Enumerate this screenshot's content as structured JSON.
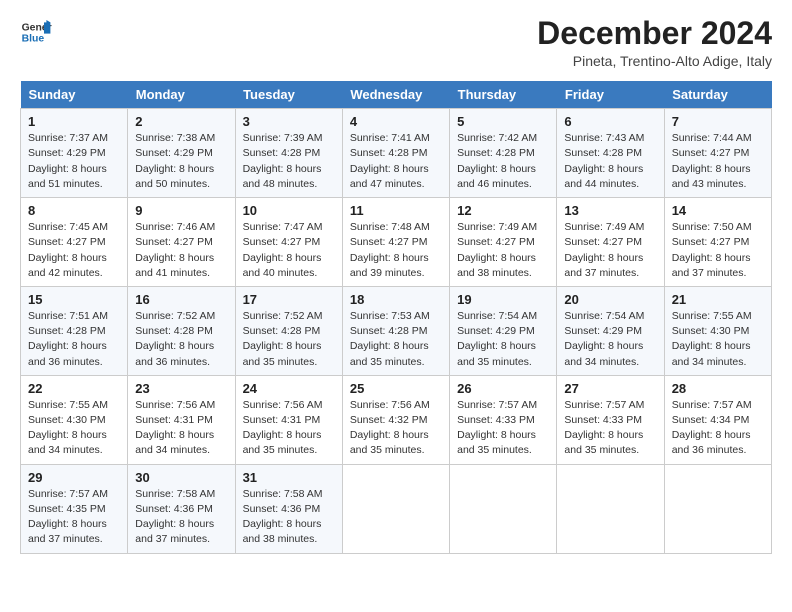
{
  "header": {
    "logo_line1": "General",
    "logo_line2": "Blue",
    "title": "December 2024",
    "subtitle": "Pineta, Trentino-Alto Adige, Italy"
  },
  "days_of_week": [
    "Sunday",
    "Monday",
    "Tuesday",
    "Wednesday",
    "Thursday",
    "Friday",
    "Saturday"
  ],
  "weeks": [
    [
      {
        "day": 1,
        "rise": "7:37 AM",
        "set": "4:29 PM",
        "daylight": "8 hours and 51 minutes."
      },
      {
        "day": 2,
        "rise": "7:38 AM",
        "set": "4:29 PM",
        "daylight": "8 hours and 50 minutes."
      },
      {
        "day": 3,
        "rise": "7:39 AM",
        "set": "4:28 PM",
        "daylight": "8 hours and 48 minutes."
      },
      {
        "day": 4,
        "rise": "7:41 AM",
        "set": "4:28 PM",
        "daylight": "8 hours and 47 minutes."
      },
      {
        "day": 5,
        "rise": "7:42 AM",
        "set": "4:28 PM",
        "daylight": "8 hours and 46 minutes."
      },
      {
        "day": 6,
        "rise": "7:43 AM",
        "set": "4:28 PM",
        "daylight": "8 hours and 44 minutes."
      },
      {
        "day": 7,
        "rise": "7:44 AM",
        "set": "4:27 PM",
        "daylight": "8 hours and 43 minutes."
      }
    ],
    [
      {
        "day": 8,
        "rise": "7:45 AM",
        "set": "4:27 PM",
        "daylight": "8 hours and 42 minutes."
      },
      {
        "day": 9,
        "rise": "7:46 AM",
        "set": "4:27 PM",
        "daylight": "8 hours and 41 minutes."
      },
      {
        "day": 10,
        "rise": "7:47 AM",
        "set": "4:27 PM",
        "daylight": "8 hours and 40 minutes."
      },
      {
        "day": 11,
        "rise": "7:48 AM",
        "set": "4:27 PM",
        "daylight": "8 hours and 39 minutes."
      },
      {
        "day": 12,
        "rise": "7:49 AM",
        "set": "4:27 PM",
        "daylight": "8 hours and 38 minutes."
      },
      {
        "day": 13,
        "rise": "7:49 AM",
        "set": "4:27 PM",
        "daylight": "8 hours and 37 minutes."
      },
      {
        "day": 14,
        "rise": "7:50 AM",
        "set": "4:27 PM",
        "daylight": "8 hours and 37 minutes."
      }
    ],
    [
      {
        "day": 15,
        "rise": "7:51 AM",
        "set": "4:28 PM",
        "daylight": "8 hours and 36 minutes."
      },
      {
        "day": 16,
        "rise": "7:52 AM",
        "set": "4:28 PM",
        "daylight": "8 hours and 36 minutes."
      },
      {
        "day": 17,
        "rise": "7:52 AM",
        "set": "4:28 PM",
        "daylight": "8 hours and 35 minutes."
      },
      {
        "day": 18,
        "rise": "7:53 AM",
        "set": "4:28 PM",
        "daylight": "8 hours and 35 minutes."
      },
      {
        "day": 19,
        "rise": "7:54 AM",
        "set": "4:29 PM",
        "daylight": "8 hours and 35 minutes."
      },
      {
        "day": 20,
        "rise": "7:54 AM",
        "set": "4:29 PM",
        "daylight": "8 hours and 34 minutes."
      },
      {
        "day": 21,
        "rise": "7:55 AM",
        "set": "4:30 PM",
        "daylight": "8 hours and 34 minutes."
      }
    ],
    [
      {
        "day": 22,
        "rise": "7:55 AM",
        "set": "4:30 PM",
        "daylight": "8 hours and 34 minutes."
      },
      {
        "day": 23,
        "rise": "7:56 AM",
        "set": "4:31 PM",
        "daylight": "8 hours and 34 minutes."
      },
      {
        "day": 24,
        "rise": "7:56 AM",
        "set": "4:31 PM",
        "daylight": "8 hours and 35 minutes."
      },
      {
        "day": 25,
        "rise": "7:56 AM",
        "set": "4:32 PM",
        "daylight": "8 hours and 35 minutes."
      },
      {
        "day": 26,
        "rise": "7:57 AM",
        "set": "4:33 PM",
        "daylight": "8 hours and 35 minutes."
      },
      {
        "day": 27,
        "rise": "7:57 AM",
        "set": "4:33 PM",
        "daylight": "8 hours and 35 minutes."
      },
      {
        "day": 28,
        "rise": "7:57 AM",
        "set": "4:34 PM",
        "daylight": "8 hours and 36 minutes."
      }
    ],
    [
      {
        "day": 29,
        "rise": "7:57 AM",
        "set": "4:35 PM",
        "daylight": "8 hours and 37 minutes."
      },
      {
        "day": 30,
        "rise": "7:58 AM",
        "set": "4:36 PM",
        "daylight": "8 hours and 37 minutes."
      },
      {
        "day": 31,
        "rise": "7:58 AM",
        "set": "4:36 PM",
        "daylight": "8 hours and 38 minutes."
      },
      null,
      null,
      null,
      null
    ]
  ],
  "labels": {
    "sunrise": "Sunrise:",
    "sunset": "Sunset:",
    "daylight": "Daylight:"
  }
}
